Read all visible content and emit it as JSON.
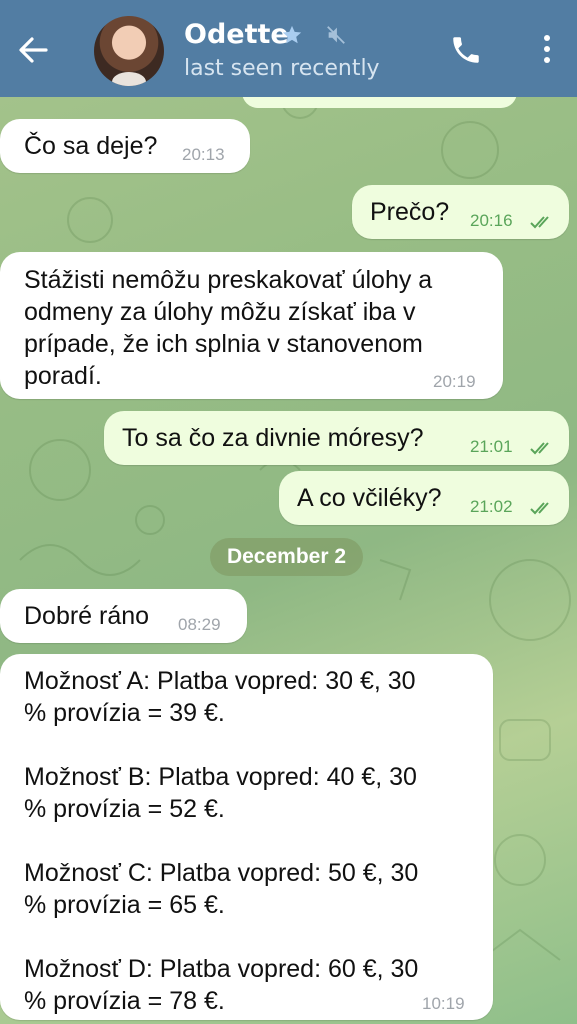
{
  "header": {
    "name": "Odette",
    "status": "last seen recently"
  },
  "messages": [
    {
      "text": "Čo sa deje?",
      "time": "20:13",
      "direction": "in"
    },
    {
      "text": "Prečo?",
      "time": "20:16",
      "direction": "out",
      "read": true
    },
    {
      "text": "Stážisti nemôžu preskakovať úlohy a\nodmeny za úlohy môžu získať iba v\nprípade, že ich splnia v stanovenom\nporadí.",
      "time": "20:19",
      "direction": "in"
    },
    {
      "text": "To sa čo za divnie móresy?",
      "time": "21:01",
      "direction": "out",
      "read": true
    },
    {
      "text": "A co včiléky?",
      "time": "21:02",
      "direction": "out",
      "read": true
    },
    {
      "text": "Dobré ráno",
      "time": "08:29",
      "direction": "in"
    },
    {
      "text": "Možnosť A: Platba vopred: 30 €, 30\n% provízia = 39 €.\n\nMožnosť B: Platba vopred: 40 €, 30\n% provízia = 52 €.\n\nMožnosť C: Platba vopred: 50 €, 30\n% provízia = 65 €.\n\nMožnosť D: Platba vopred: 60 €, 30\n% provízia = 78 €.",
      "time": "10:19",
      "direction": "in"
    }
  ],
  "date_separator": "December 2",
  "colors": {
    "header": "#527da3",
    "incoming_bubble": "#ffffff",
    "outgoing_bubble": "#effdde",
    "outgoing_time": "#5aa55a"
  }
}
